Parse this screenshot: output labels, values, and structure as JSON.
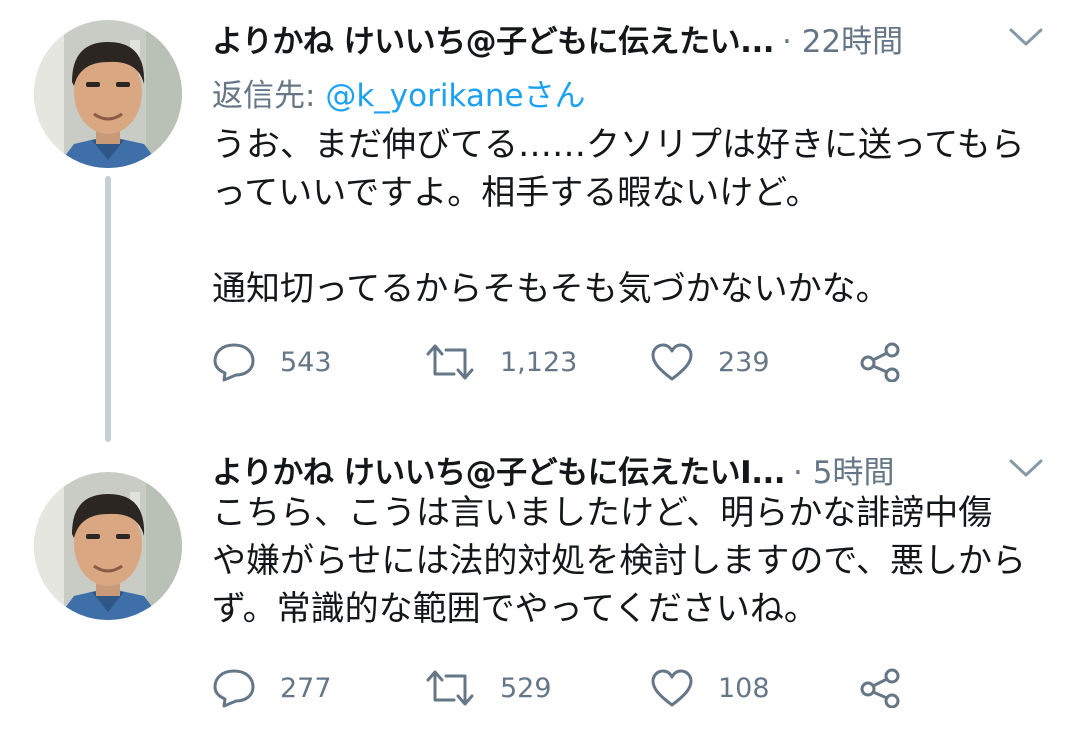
{
  "colors": {
    "text": "#14171a",
    "secondary": "#657786",
    "link": "#1da1f2",
    "thread_line": "#c4cfd6"
  },
  "tweets": [
    {
      "author": "よりかね けいいち@子どもに伝えたい...",
      "time": "· 22時間",
      "reply_to_label": "返信先:",
      "reply_to_handle": "@k_yorikane",
      "reply_to_suffix": "さん",
      "lines": [
        "うお、まだ伸びてる……クソリプは好きに送ってもら",
        "っていいですよ。相手する暇ないけど。",
        "通知切ってるからそもそも気づかないかな。"
      ],
      "replies": "543",
      "retweets": "1,123",
      "likes": "239",
      "icons": [
        "reply-icon",
        "retweet-icon",
        "like-icon",
        "share-icon",
        "chevron-down-icon"
      ]
    },
    {
      "author": "よりかね けいいち@子どもに伝えたいI...",
      "time": "· 5時間",
      "lines": [
        "こちら、こうは言いましたけど、明らかな誹謗中傷",
        "や嫌がらせには法的対処を検討しますので、悪しから",
        "ず。常識的な範囲でやってくださいね。"
      ],
      "replies": "277",
      "retweets": "529",
      "likes": "108",
      "icons": [
        "reply-icon",
        "retweet-icon",
        "like-icon",
        "share-icon",
        "chevron-down-icon"
      ]
    }
  ]
}
